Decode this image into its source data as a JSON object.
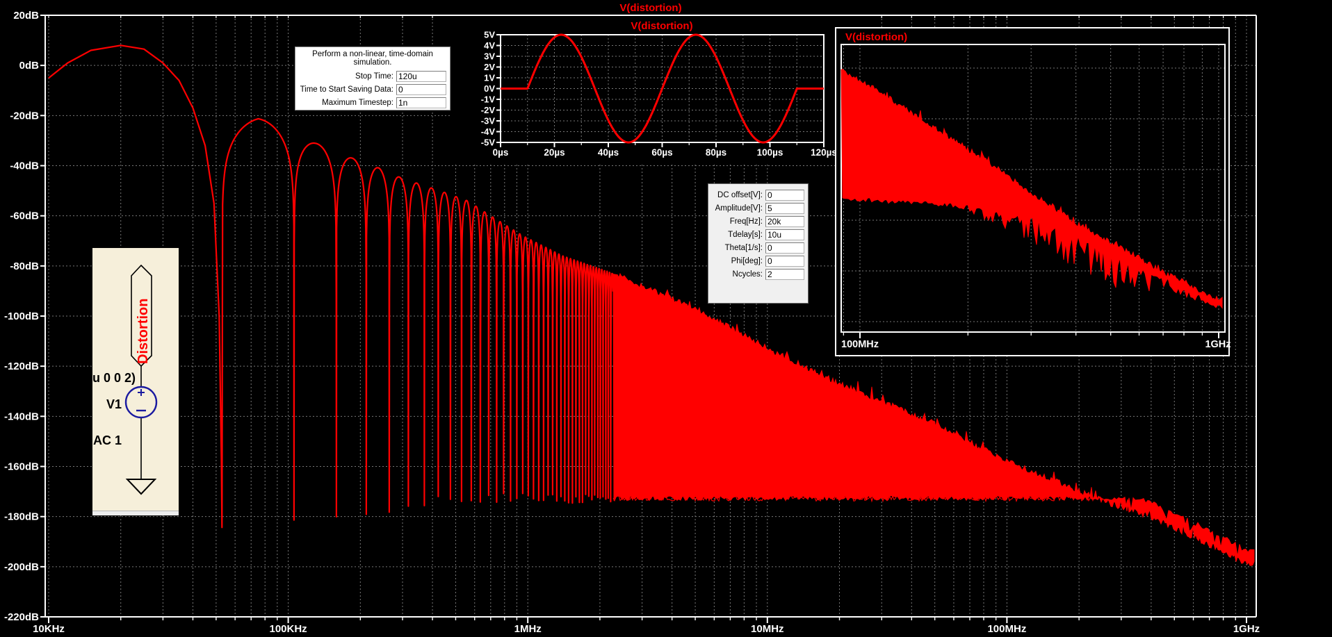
{
  "app": {
    "name": "ltspice-waveform-viewer",
    "background": "#000000"
  },
  "colors": {
    "trace": "#ff0000",
    "axis": "#ffffff",
    "grid": "#787878",
    "title": "#ff0000",
    "schematic_bg": "#f6efda",
    "schematic_symbol": "#1a1aa0",
    "dialog_bg": "#ffffff",
    "param_dialog_bg": "#f0f0f0"
  },
  "chart_data": [
    {
      "id": "main_fft",
      "type": "line",
      "title": "V(distortion)",
      "legend_position": "top-center",
      "grid": true,
      "x_axis": {
        "scale": "log",
        "min_hz": 10000,
        "max_hz": 1000000000,
        "tick_labels": [
          "10KHz",
          "100KHz",
          "1MHz",
          "10MHz",
          "100MHz",
          "1GHz"
        ],
        "tick_values_hz": [
          10000,
          100000,
          1000000,
          10000000,
          100000000,
          1000000000
        ]
      },
      "y_axis": {
        "unit": "dB",
        "max_db": 20,
        "min_db": -220,
        "step_db": 20,
        "tick_labels": [
          "20dB",
          "0dB",
          "-20dB",
          "-40dB",
          "-60dB",
          "-80dB",
          "-100dB",
          "-120dB",
          "-140dB",
          "-160dB",
          "-180dB",
          "-200dB",
          "-220dB"
        ]
      },
      "main_lobe_points_hz_db": [
        [
          10000,
          -5
        ],
        [
          12000,
          1
        ],
        [
          15000,
          6
        ],
        [
          20000,
          8
        ],
        [
          25000,
          6.5
        ],
        [
          30000,
          1
        ],
        [
          35000,
          -6
        ],
        [
          40000,
          -17
        ],
        [
          45000,
          -32
        ],
        [
          49000,
          -55
        ],
        [
          51500,
          -100
        ],
        [
          52600,
          -158
        ]
      ],
      "null_spacing_hz": 52900,
      "lobe_peak_envelope_hz_db": [
        [
          75000,
          -21
        ],
        [
          130000,
          -31
        ],
        [
          185000,
          -37
        ],
        [
          240000,
          -41
        ],
        [
          290000,
          -44.5
        ],
        [
          345000,
          -47
        ],
        [
          430000,
          -50
        ],
        [
          560000,
          -54
        ],
        [
          700000,
          -60
        ],
        [
          955000,
          -68
        ],
        [
          1400000,
          -76
        ],
        [
          2275000,
          -83
        ]
      ],
      "merged_top_envelope_hz_db": [
        [
          2275000,
          -83
        ],
        [
          3000000,
          -88
        ],
        [
          5000000,
          -97
        ],
        [
          10000000,
          -113
        ],
        [
          20000000,
          -127
        ],
        [
          50000000,
          -143
        ],
        [
          100000000,
          -158
        ],
        [
          160000000,
          -166
        ],
        [
          240000000,
          -173
        ],
        [
          400000000,
          -180
        ],
        [
          700000000,
          -191
        ],
        [
          1000000000,
          -199
        ]
      ],
      "noise_floor_db": -172.6
    },
    {
      "id": "time_domain",
      "type": "line",
      "title": "V(distortion)",
      "grid": true,
      "x_axis": {
        "unit": "µs",
        "min_us": 0,
        "max_us": 120,
        "step_us": 20,
        "tick_labels": [
          "0µs",
          "20µs",
          "40µs",
          "60µs",
          "80µs",
          "100µs",
          "120µs"
        ]
      },
      "y_axis": {
        "unit": "V",
        "min_v": -5,
        "max_v": 5,
        "step_v": 1,
        "tick_labels": [
          "5V",
          "4V",
          "3V",
          "2V",
          "1V",
          "0V",
          "-1V",
          "-2V",
          "-3V",
          "-4V",
          "-5V"
        ]
      },
      "signal": {
        "shape": "delayed sine burst",
        "amplitude_v": 5,
        "freq_hz": 20000,
        "tdelay_us": 10,
        "ncycles": 2,
        "level_outside_burst_v": 0
      }
    },
    {
      "id": "rf_zoom",
      "type": "area",
      "title": "V(distortion)",
      "grid": true,
      "x_axis": {
        "scale": "log",
        "min_hz": 88000000,
        "max_hz": 1050000000,
        "tick_labels": [
          "100MHz",
          "1GHz"
        ],
        "tick_values_hz": [
          100000000,
          1000000000
        ]
      },
      "y_axis": {
        "unit": "dB",
        "max_db": -151,
        "min_db": -209,
        "tick_labels": []
      },
      "band_top_mhz_db": [
        [
          88,
          -156
        ],
        [
          110,
          -160
        ],
        [
          140,
          -165
        ],
        [
          180,
          -170
        ],
        [
          230,
          -175
        ],
        [
          300,
          -181
        ],
        [
          400,
          -187
        ],
        [
          500,
          -191
        ],
        [
          600,
          -194
        ],
        [
          700,
          -197
        ],
        [
          800,
          -199
        ],
        [
          900,
          -201
        ],
        [
          1000,
          -202.5
        ]
      ],
      "band_bottom_mhz_db": [
        [
          88,
          -182
        ],
        [
          150,
          -183
        ],
        [
          220,
          -184
        ],
        [
          300,
          -186
        ],
        [
          380,
          -189
        ],
        [
          470,
          -192
        ],
        [
          560,
          -195
        ],
        [
          650,
          -197
        ],
        [
          750,
          -199
        ],
        [
          850,
          -201
        ],
        [
          1000,
          -204
        ]
      ]
    }
  ],
  "sim_dialog": {
    "description": "Perform a non-linear, time-domain simulation.",
    "fields": [
      {
        "label": "Stop Time:",
        "value": "120u"
      },
      {
        "label": "Time to Start Saving Data:",
        "value": "0"
      },
      {
        "label": "Maximum Timestep:",
        "value": "1n"
      }
    ]
  },
  "source_dialog": {
    "fields": [
      {
        "label": "DC offset[V]:",
        "value": "0"
      },
      {
        "label": "Amplitude[V]:",
        "value": "5"
      },
      {
        "label": "Freq[Hz]:",
        "value": "20k"
      },
      {
        "label": "Tdelay[s]:",
        "value": "10u"
      },
      {
        "label": "Theta[1/s]:",
        "value": "0"
      },
      {
        "label": "Phi[deg]:",
        "value": "0"
      },
      {
        "label": "Ncycles:",
        "value": "2"
      }
    ]
  },
  "schematic": {
    "net_label": "Distortion",
    "directive_fragment": "u 0 0 2)",
    "designator": "V1",
    "ac_spec": "AC 1"
  }
}
